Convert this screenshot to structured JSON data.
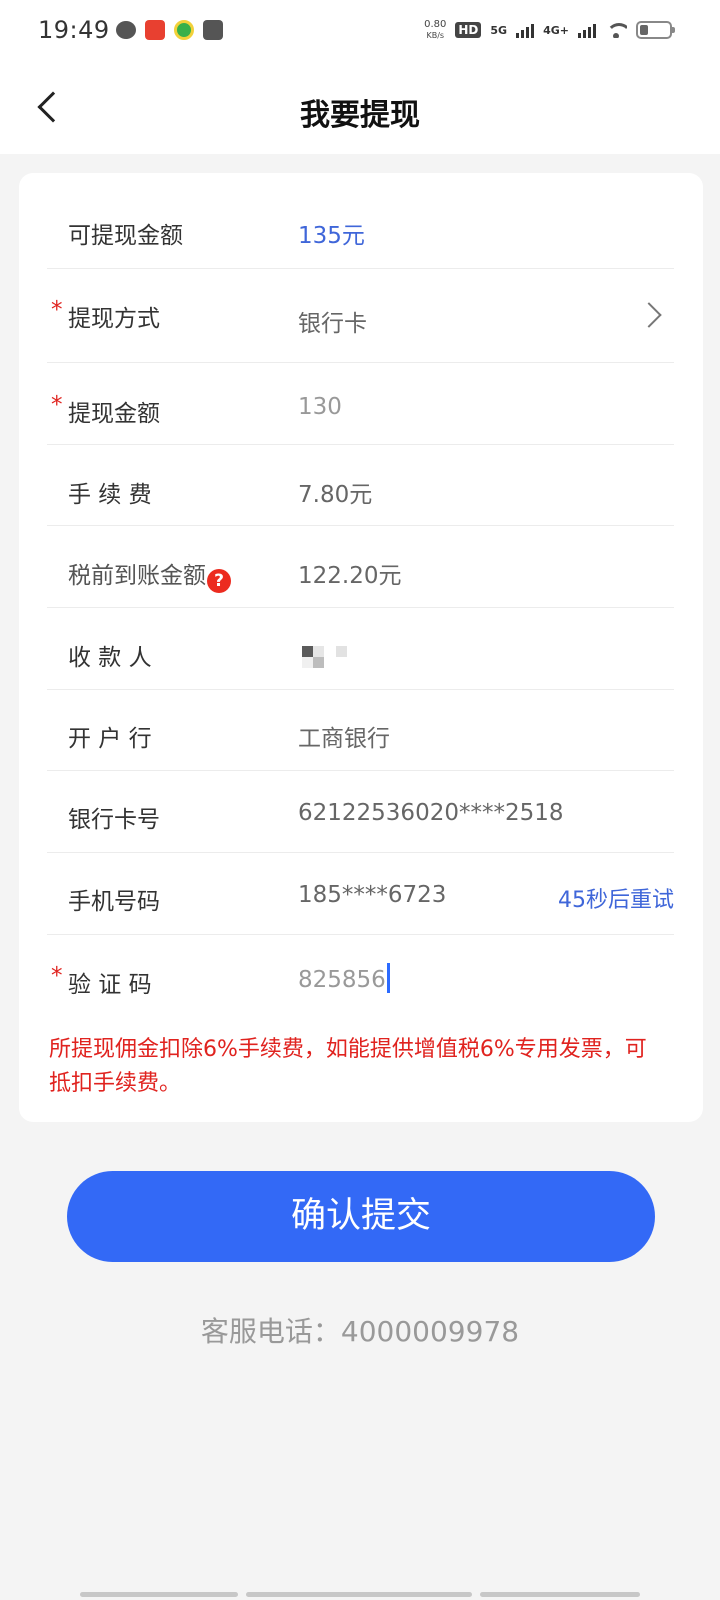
{
  "status_bar": {
    "time": "19:49",
    "notification_icons": [
      "chat-bubble-icon",
      "red-app-icon",
      "green-app-icon",
      "calendar-icon"
    ],
    "net_speed_value": "0.80",
    "net_speed_unit": "KB/s",
    "hd_label": "HD",
    "signal_1_label": "5G",
    "signal_2_label": "4G+"
  },
  "header": {
    "title": "我要提现"
  },
  "form": {
    "available_amount": {
      "label": "可提现金额",
      "value": "135元"
    },
    "withdraw_method": {
      "label": "提现方式",
      "value": "银行卡",
      "required": true
    },
    "withdraw_amount": {
      "label": "提现金额",
      "value": "130",
      "required": true
    },
    "fee": {
      "label": "手 续 费",
      "value": "7.80元"
    },
    "pretax_amount": {
      "label": "税前到账金额",
      "help_icon": "?",
      "value": "122.20元"
    },
    "payee": {
      "label": "收 款 人"
    },
    "bank": {
      "label": "开 户 行",
      "value": "工商银行"
    },
    "card_number": {
      "label": "银行卡号",
      "value": "62122536020****2518"
    },
    "phone": {
      "label": "手机号码",
      "value": "185****6723",
      "retry_text": "45秒后重试"
    },
    "verification_code": {
      "label": "验 证 码",
      "value": "825856",
      "required": true
    }
  },
  "notice": "所提现佣金扣除6%手续费，如能提供增值税6%专用发票，可抵扣手续费。",
  "submit_label": "确认提交",
  "service_phone": "客服电话：4000009978",
  "required_mark": "*"
}
